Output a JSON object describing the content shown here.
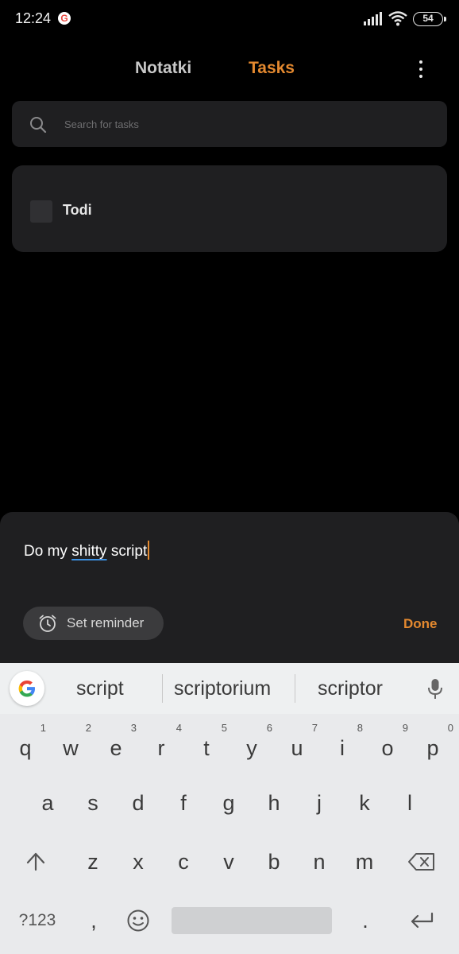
{
  "status_bar": {
    "time": "12:24",
    "google_badge": "G",
    "battery": "54"
  },
  "tabs": [
    {
      "label": "Notatki",
      "active": false
    },
    {
      "label": "Tasks",
      "active": true
    }
  ],
  "menu": {
    "icon": "more-vertical-icon"
  },
  "search": {
    "placeholder": "Search for tasks",
    "value": ""
  },
  "tasks": [
    {
      "title": "Todi",
      "checked": false
    }
  ],
  "new_task": {
    "text_before": "Do my ",
    "text_misspelled": "shitty",
    "text_after": " script",
    "reminder_label": "Set reminder",
    "done_label": "Done"
  },
  "keyboard": {
    "suggestions": [
      "script",
      "scriptorium",
      "scriptor"
    ],
    "row1": [
      "q",
      "w",
      "e",
      "r",
      "t",
      "y",
      "u",
      "i",
      "o",
      "p"
    ],
    "row1_hints": [
      "1",
      "2",
      "3",
      "4",
      "5",
      "6",
      "7",
      "8",
      "9",
      "0"
    ],
    "row2": [
      "a",
      "s",
      "d",
      "f",
      "g",
      "h",
      "j",
      "k",
      "l"
    ],
    "row3": [
      "z",
      "x",
      "c",
      "v",
      "b",
      "n",
      "m"
    ],
    "symbols_label": "?123",
    "comma": ",",
    "period": "."
  },
  "colors": {
    "accent": "#e4892f",
    "background": "#000000",
    "card": "#1f1f21",
    "keyboard": "#e9eaec"
  }
}
